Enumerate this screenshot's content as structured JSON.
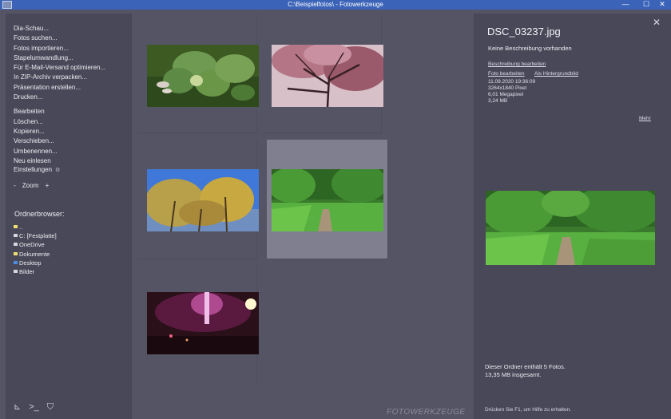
{
  "window": {
    "title": "C:\\Beispielfotos\\ - Fotowerkzeuge",
    "controls": [
      "—",
      "☐",
      "✕"
    ]
  },
  "sidebar": {
    "menu_group1": [
      "Dia-Schau...",
      "Fotos suchen...",
      "Fotos importieren...",
      "Stapelumwandlung...",
      "Für E-Mail-Versand optimieren...",
      "In ZIP-Archiv verpacken...",
      "Präsentation erstellen...",
      "Drucken..."
    ],
    "menu_group2": [
      "Bearbeiten",
      "Löschen...",
      "Kopieren...",
      "Verschieben...",
      "Umbenennen...",
      "Neu einlesen"
    ],
    "settings_label": "Einstellungen",
    "zoom_minus": "-",
    "zoom_label": "Zoom",
    "zoom_plus": "+",
    "folder_browser_title": "Ordnerbrowser:",
    "folders": [
      {
        "label": "..",
        "color": "#f0e070"
      },
      {
        "label": "C: [Festplatte]",
        "color": "#d8d8e0"
      },
      {
        "label": "OneDrive",
        "color": "#d8d8e0"
      },
      {
        "label": "Dokumente",
        "color": "#f0e070"
      },
      {
        "label": "Desktop",
        "color": "#4a8fe0"
      },
      {
        "label": "Bilder",
        "color": "#d8d8e0"
      }
    ]
  },
  "grid": {
    "brand": "FOTOWERKZEUGE",
    "thumbnails": [
      {
        "name": "hosta-plant",
        "selected": false
      },
      {
        "name": "cherry-blossom",
        "selected": false
      },
      {
        "name": "autumn-tree",
        "selected": false
      },
      {
        "name": "forest-path",
        "selected": true
      },
      {
        "name": "fireworks",
        "selected": false
      }
    ]
  },
  "details": {
    "filename": "DSC_03237.jpg",
    "description": "Keine Beschreibung vorhanden",
    "edit_description": "Beschreibung bearbeiten",
    "edit_photo": "Foto bearbeiten",
    "set_wallpaper": "Als Hintergrundbild",
    "date": "11.09.2020 19:36:09",
    "dimensions": "3264x1840 Pixel",
    "megapixel": "6,01 Megapixel",
    "filesize": "3,24 MB",
    "more": "Mehr",
    "summary_line1": "Dieser Ordner enthält 5 Fotos.",
    "summary_line2": "13,35 MB insgesamt.",
    "help": "Drücken Sie F1, um Hilfe zu erhalten."
  }
}
